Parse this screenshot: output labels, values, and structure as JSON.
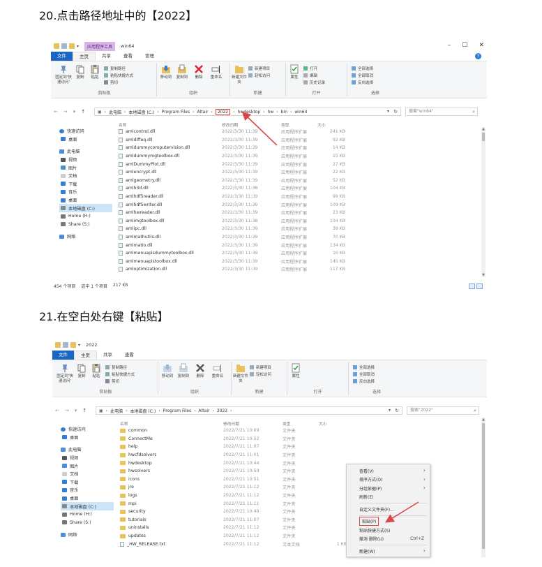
{
  "step20": {
    "heading": "20.点击路径地址中的【2022】"
  },
  "step21": {
    "heading": "21.在空白处右键【粘贴】"
  },
  "colors": {
    "accent": "#1a66c2",
    "highlight": "#d94848",
    "selection": "#cce4f7",
    "folder": "#e8c15a"
  },
  "explorer1": {
    "title": "win64",
    "tool_tab": "应用程序工具",
    "tabs": [
      "文件",
      "主页",
      "共享",
      "查看"
    ],
    "manage_tab": "管理",
    "ribbon": {
      "pin_label": "固定到'快速访问'",
      "copy_label": "复制",
      "paste_label": "粘贴",
      "copy_path": "复制路径",
      "paste_shortcut": "粘贴快捷方式",
      "cut": "剪切",
      "move_to": "移动到",
      "copy_to": "复制到",
      "delete": "删除",
      "rename": "重命名",
      "new_folder": "新建文件夹",
      "new_item": "新建项目",
      "easy_access": "轻松访问",
      "properties": "属性",
      "open": "打开",
      "edit": "编辑",
      "history": "历史记录",
      "select_all": "全部选择",
      "select_none": "全部取消",
      "invert_selection": "反向选择",
      "groups": [
        "剪贴板",
        "组织",
        "新建",
        "打开",
        "选择"
      ]
    },
    "address": {
      "crumbs": [
        "此电脑",
        "本地磁盘 (C:)",
        "Program Files",
        "Altair",
        "2022",
        "hwdesktop",
        "hw",
        "bin",
        "win64"
      ],
      "search_placeholder": "搜索\"win64\""
    },
    "nav": [
      "快速访问",
      "桌面",
      "此电脑",
      "视频",
      "图片",
      "文档",
      "下载",
      "音乐",
      "桌面",
      "本地磁盘 (C:)",
      "Home (H:)",
      "Share (S:)",
      "网络"
    ],
    "columns": {
      "name": "名称",
      "date": "修改日期",
      "type": "类型",
      "size": "大小"
    },
    "files": [
      {
        "name": "amlcontrol.dll",
        "date": "2022/3/30 11:39",
        "type": "应用程序扩展",
        "size": "241 KB"
      },
      {
        "name": "amldiffeq.dll",
        "date": "2022/3/30 11:39",
        "type": "应用程序扩展",
        "size": "92 KB"
      },
      {
        "name": "amldummycomputervision.dll",
        "date": "2022/3/30 11:39",
        "type": "应用程序扩展",
        "size": "14 KB"
      },
      {
        "name": "amldummymgtoolbox.dll",
        "date": "2022/3/30 11:39",
        "type": "应用程序扩展",
        "size": "15 KB"
      },
      {
        "name": "amlDummyPlot.dll",
        "date": "2022/3/30 11:39",
        "type": "应用程序扩展",
        "size": "27 KB"
      },
      {
        "name": "amlencrypt.dll",
        "date": "2022/3/30 11:39",
        "type": "应用程序扩展",
        "size": "22 KB"
      },
      {
        "name": "amlgeometry.dll",
        "date": "2022/3/30 11:39",
        "type": "应用程序扩展",
        "size": "52 KB"
      },
      {
        "name": "amlh3d.dll",
        "date": "2022/3/30 11:38",
        "type": "应用程序扩展",
        "size": "104 KB"
      },
      {
        "name": "amlhdf5reader.dll",
        "date": "2022/3/30 11:39",
        "type": "应用程序扩展",
        "size": "99 KB"
      },
      {
        "name": "amlhdf5writer.dll",
        "date": "2022/3/30 11:39",
        "type": "应用程序扩展",
        "size": "109 KB"
      },
      {
        "name": "amlhwreader.dll",
        "date": "2022/3/30 11:39",
        "type": "应用程序扩展",
        "size": "23 KB"
      },
      {
        "name": "amlimgtoolbox.dll",
        "date": "2022/3/30 11:38",
        "type": "应用程序扩展",
        "size": "104 KB"
      },
      {
        "name": "amlipc.dll",
        "date": "2022/3/30 11:39",
        "type": "应用程序扩展",
        "size": "38 KB"
      },
      {
        "name": "amlmathutils.dll",
        "date": "2022/3/30 11:39",
        "type": "应用程序扩展",
        "size": "70 KB"
      },
      {
        "name": "amlmatio.dll",
        "date": "2022/3/30 11:39",
        "type": "应用程序扩展",
        "size": "134 KB"
      },
      {
        "name": "amlmenuapisdummytoolbox.dll",
        "date": "2022/3/30 11:39",
        "type": "应用程序扩展",
        "size": "16 KB"
      },
      {
        "name": "amlmenuapistoolbox.dll",
        "date": "2022/3/30 11:39",
        "type": "应用程序扩展",
        "size": "145 KB"
      },
      {
        "name": "amloptimization.dll",
        "date": "2022/3/30 11:39",
        "type": "应用程序扩展",
        "size": "117 KB"
      }
    ],
    "status": {
      "count": "454 个项目",
      "selected": "选中 1 个项目",
      "size": "217 KB"
    }
  },
  "explorer2": {
    "title": "2022",
    "tabs": [
      "文件",
      "主页",
      "共享",
      "查看"
    ],
    "address": {
      "crumbs": [
        "此电脑",
        "本地磁盘 (C:)",
        "Program Files",
        "Altair",
        "2022"
      ],
      "search_placeholder": "搜索\"2022\""
    },
    "nav": [
      "快速访问",
      "桌面",
      "此电脑",
      "视频",
      "图片",
      "文档",
      "下载",
      "音乐",
      "桌面",
      "本地磁盘 (C:)",
      "Home (H:)",
      "Share (S:)",
      "网络"
    ],
    "columns": {
      "name": "名称",
      "date": "修改日期",
      "type": "类型",
      "size": "大小"
    },
    "files": [
      {
        "name": "common",
        "date": "2022/7/21 10:09",
        "type": "文件夹",
        "size": "",
        "icon": "folder"
      },
      {
        "name": "ConnectMe",
        "date": "2022/7/21 10:52",
        "type": "文件夹",
        "size": "",
        "icon": "folder"
      },
      {
        "name": "help",
        "date": "2022/7/21 11:07",
        "type": "文件夹",
        "size": "",
        "icon": "folder"
      },
      {
        "name": "hwcfdsolvers",
        "date": "2022/7/21 11:01",
        "type": "文件夹",
        "size": "",
        "icon": "folder"
      },
      {
        "name": "hwdesktop",
        "date": "2022/7/21 10:44",
        "type": "文件夹",
        "size": "",
        "icon": "folder"
      },
      {
        "name": "hwsolvers",
        "date": "2022/7/21 10:59",
        "type": "文件夹",
        "size": "",
        "icon": "folder"
      },
      {
        "name": "icons",
        "date": "2022/7/21 10:51",
        "type": "文件夹",
        "size": "",
        "icon": "folder"
      },
      {
        "name": "jre",
        "date": "2022/7/21 11:12",
        "type": "文件夹",
        "size": "",
        "icon": "folder"
      },
      {
        "name": "logs",
        "date": "2022/7/21 11:12",
        "type": "文件夹",
        "size": "",
        "icon": "folder"
      },
      {
        "name": "mpi",
        "date": "2022/7/21 11:11",
        "type": "文件夹",
        "size": "",
        "icon": "folder"
      },
      {
        "name": "security",
        "date": "2022/7/21 10:49",
        "type": "文件夹",
        "size": "",
        "icon": "folder"
      },
      {
        "name": "tutorials",
        "date": "2022/7/21 11:07",
        "type": "文件夹",
        "size": "",
        "icon": "folder"
      },
      {
        "name": "uninstalls",
        "date": "2022/7/21 11:12",
        "type": "文件夹",
        "size": "",
        "icon": "folder"
      },
      {
        "name": "updates",
        "date": "2022/7/21 11:12",
        "type": "文件夹",
        "size": "",
        "icon": "folder"
      },
      {
        "name": "_HW_RELEASE.txt",
        "date": "2022/7/21 11:12",
        "type": "文本文档",
        "size": "1 KB",
        "icon": "txt"
      }
    ],
    "context_menu": {
      "view": "查看(V)",
      "sort": "排序方式(O)",
      "group": "分组依据(P)",
      "refresh": "刷新(E)",
      "customize": "自定义文件夹(F)...",
      "paste": "粘贴(P)",
      "paste_shortcut": "粘贴快捷方式(S)",
      "undo": "撤消 删除(U)",
      "undo_accel": "Ctrl+Z",
      "new": "新建(W)"
    }
  }
}
